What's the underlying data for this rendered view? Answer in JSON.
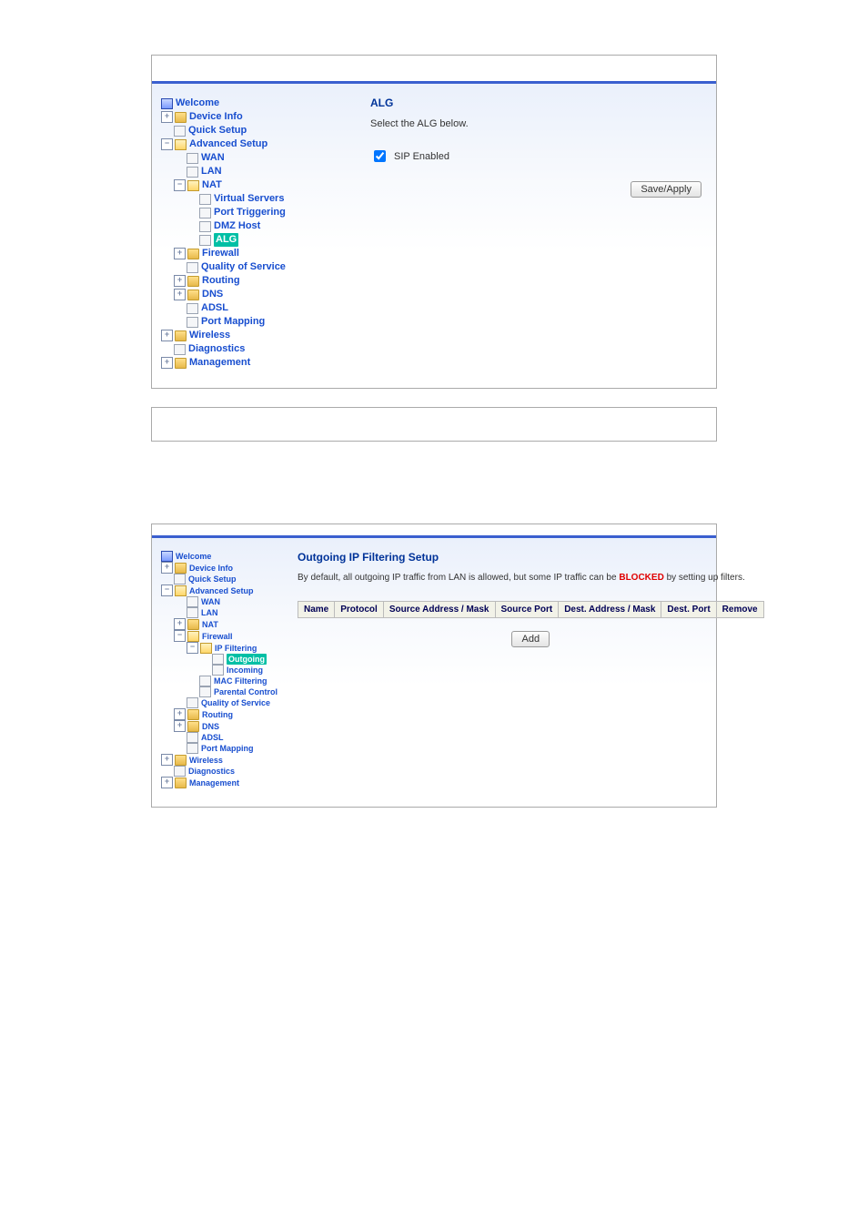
{
  "screenshot1": {
    "nav": {
      "welcome": "Welcome",
      "device_info": "Device Info",
      "quick_setup": "Quick Setup",
      "advanced_setup": "Advanced Setup",
      "wan": "WAN",
      "lan": "LAN",
      "nat": "NAT",
      "virtual_servers": "Virtual Servers",
      "port_triggering": "Port Triggering",
      "dmz_host": "DMZ Host",
      "alg": "ALG",
      "firewall": "Firewall",
      "qos": "Quality of Service",
      "routing": "Routing",
      "dns": "DNS",
      "adsl": "ADSL",
      "port_mapping": "Port Mapping",
      "wireless": "Wireless",
      "diagnostics": "Diagnostics",
      "management": "Management"
    },
    "content": {
      "title": "ALG",
      "desc": "Select the ALG below.",
      "checkbox_label": "SIP Enabled",
      "save_apply": "Save/Apply"
    }
  },
  "screenshot2": {
    "nav": {
      "welcome": "Welcome",
      "device_info": "Device Info",
      "quick_setup": "Quick Setup",
      "advanced_setup": "Advanced Setup",
      "wan": "WAN",
      "lan": "LAN",
      "nat": "NAT",
      "firewall": "Firewall",
      "ip_filtering": "IP Filtering",
      "outgoing": "Outgoing",
      "incoming": "Incoming",
      "mac_filtering": "MAC Filtering",
      "parental_control": "Parental Control",
      "qos": "Quality of Service",
      "routing": "Routing",
      "dns": "DNS",
      "adsl": "ADSL",
      "port_mapping": "Port Mapping",
      "wireless": "Wireless",
      "diagnostics": "Diagnostics",
      "management": "Management"
    },
    "content": {
      "title": "Outgoing IP Filtering Setup",
      "desc_pre": "By default, all outgoing IP traffic from LAN is allowed, but some IP traffic can be ",
      "desc_blocked": "BLOCKED",
      "desc_post": " by setting up filters.",
      "cols": {
        "name": "Name",
        "protocol": "Protocol",
        "src_addr": "Source Address / Mask",
        "src_port": "Source Port",
        "dst_addr": "Dest. Address / Mask",
        "dst_port": "Dest. Port",
        "remove": "Remove"
      },
      "add_btn": "Add"
    }
  }
}
